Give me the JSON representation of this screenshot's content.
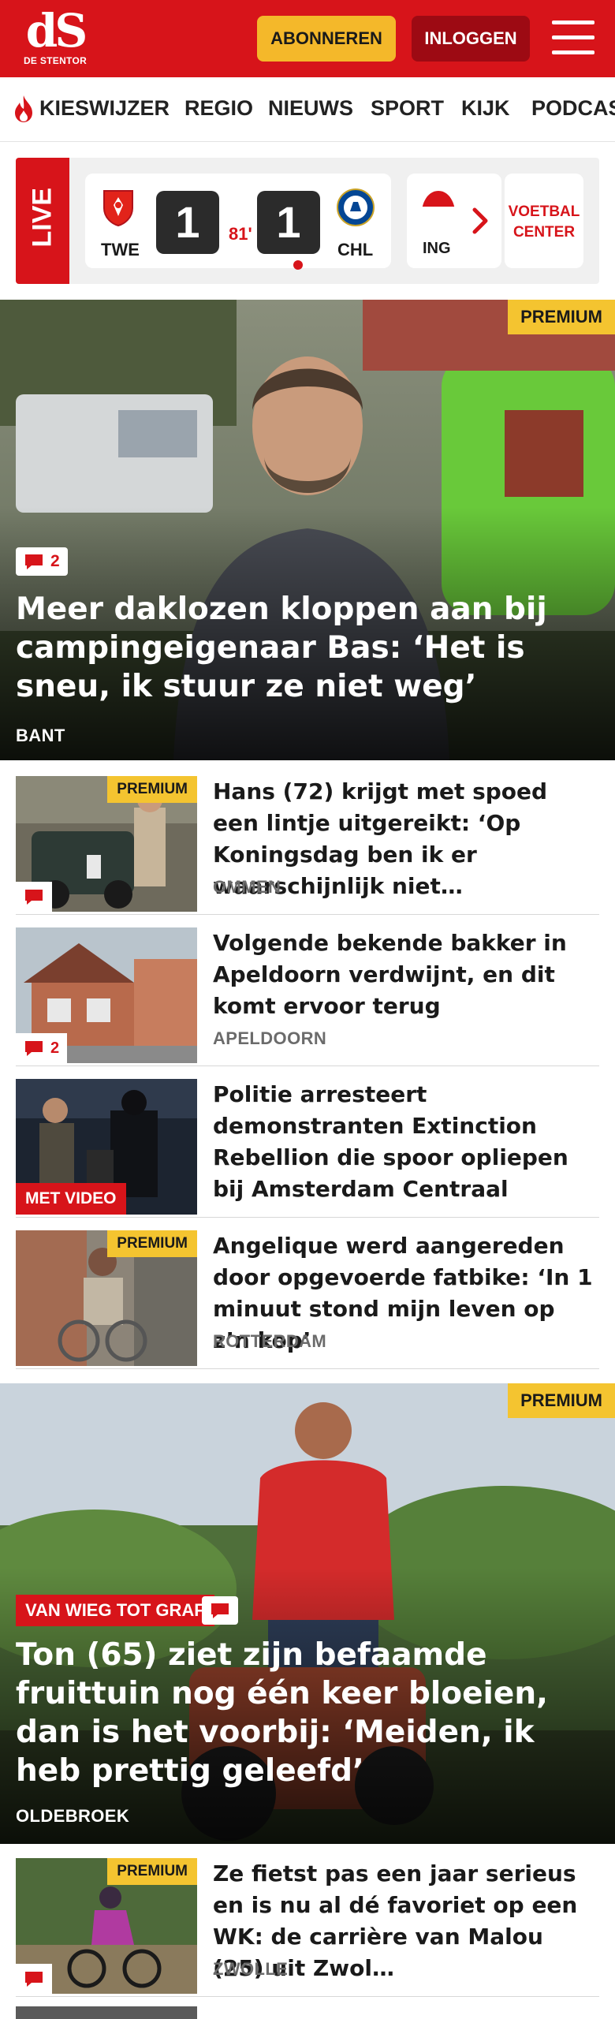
{
  "header": {
    "logo_mark": "dS",
    "logo_sub": "DE STENTOR",
    "subscribe_label": "ABONNEREN",
    "login_label": "INLOGGEN",
    "brand_color": "#d7141a"
  },
  "nav": {
    "items": [
      "KIESWIJZER",
      "REGIO",
      "NIEUWS",
      "SPORT",
      "KIJK",
      "PODCAS"
    ]
  },
  "live": {
    "badge": "LIVE",
    "match": {
      "home_code": "TWE",
      "home_score": "1",
      "minute": "81'",
      "away_score": "1",
      "away_code": "CHL"
    },
    "next_card_code": "ING",
    "voetbal_center": "VOETBAL CENTER"
  },
  "hero1": {
    "premium": "PREMIUM",
    "comments": "2",
    "title": "Meer daklozen kloppen aan bij campingeigenaar Bas: ‘Het is sneu, ik stuur ze niet weg’",
    "location": "BANT"
  },
  "articles": [
    {
      "premium": "PREMIUM",
      "comments": "",
      "title": "Hans (72) krijgt met spoed een lintje uitgereikt: ‘Op Koningsdag ben ik er waarschijnlijk niet…",
      "location": "OMMEN"
    },
    {
      "comments": "2",
      "title": "Volgende bekende bakker in Apeldoorn verdwijnt, en dit komt ervoor terug",
      "location": "APELDOORN"
    },
    {
      "video": "MET VIDEO",
      "title": "Politie arresteert demonstranten Extinction Rebellion die spoor opliepen bij Amsterdam Centraal",
      "location": ""
    },
    {
      "premium": "PREMIUM",
      "title": "Angelique werd aangereden door opgevoerde fatbike: ‘In 1 minuut stond mijn leven op z’n kop’",
      "location": "ROTTERDAM"
    }
  ],
  "hero2": {
    "premium": "PREMIUM",
    "section_label": "VAN WIEG TOT GRAF",
    "title": "Ton (65) ziet zijn befaamde fruittuin nog één keer bloeien, dan is het voorbij: ‘Meiden, ik heb prettig geleefd’",
    "location": "OLDEBROEK"
  },
  "article_last": {
    "premium": "PREMIUM",
    "title": "Ze fietst pas een jaar serieus en is nu al dé favoriet op een WK: de carrière van Malou (25) uit Zwol…",
    "location": "ZWOLLE"
  },
  "colors": {
    "premium": "#f4c430",
    "subscribe": "#f4b82a",
    "login": "#9d0a13",
    "score_box": "#2b2b2b"
  }
}
